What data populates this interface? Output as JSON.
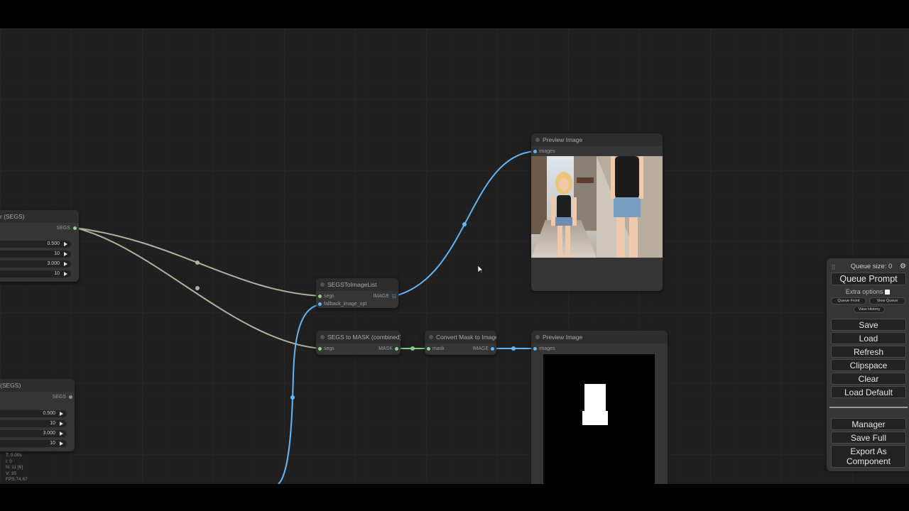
{
  "nodes": {
    "detailer_a": {
      "title_partial": "r (SEGS)",
      "output": "SEGS",
      "widgets": [
        "0.500",
        "10",
        "3.000",
        "10"
      ]
    },
    "detailer_b": {
      "title_partial": "(SEGS)",
      "output": "SEGS",
      "widgets": [
        "0.500",
        "10",
        "3.000",
        "10"
      ]
    },
    "segs_to_image_list": {
      "title": "SEGSToImageList",
      "inputs": [
        "segs",
        "fallback_image_opt"
      ],
      "output": "IMAGE"
    },
    "segs_to_mask": {
      "title": "SEGS to MASK (combined)",
      "input": "segs",
      "output": "MASK"
    },
    "convert_mask": {
      "title": "Convert Mask to Image",
      "input": "mask",
      "output": "IMAGE"
    },
    "preview_top": {
      "title": "Preview Image",
      "input": "images"
    },
    "preview_bottom": {
      "title": "Preview Image",
      "input": "images"
    }
  },
  "stats": [
    "T: 0.00s",
    "I: 0",
    "N: 11 [6]",
    "V: 35",
    "FPS:74.67"
  ],
  "menu": {
    "queue_size": "Queue size: 0",
    "queue_prompt": "Queue Prompt",
    "extra_options": "Extra options",
    "queue_front": "Queue Front",
    "view_queue": "View Queue",
    "view_history": "View History",
    "save": "Save",
    "load": "Load",
    "refresh": "Refresh",
    "clipspace": "Clipspace",
    "clear": "Clear",
    "load_default": "Load Default",
    "manager": "Manager",
    "save_full": "Save Full",
    "export_line1": "Export As",
    "export_line2": "Component"
  },
  "colors": {
    "image_link": "#64b5f6",
    "mask_link": "#81c784",
    "segs_link": "#b0b0a0",
    "background": "#202020"
  }
}
